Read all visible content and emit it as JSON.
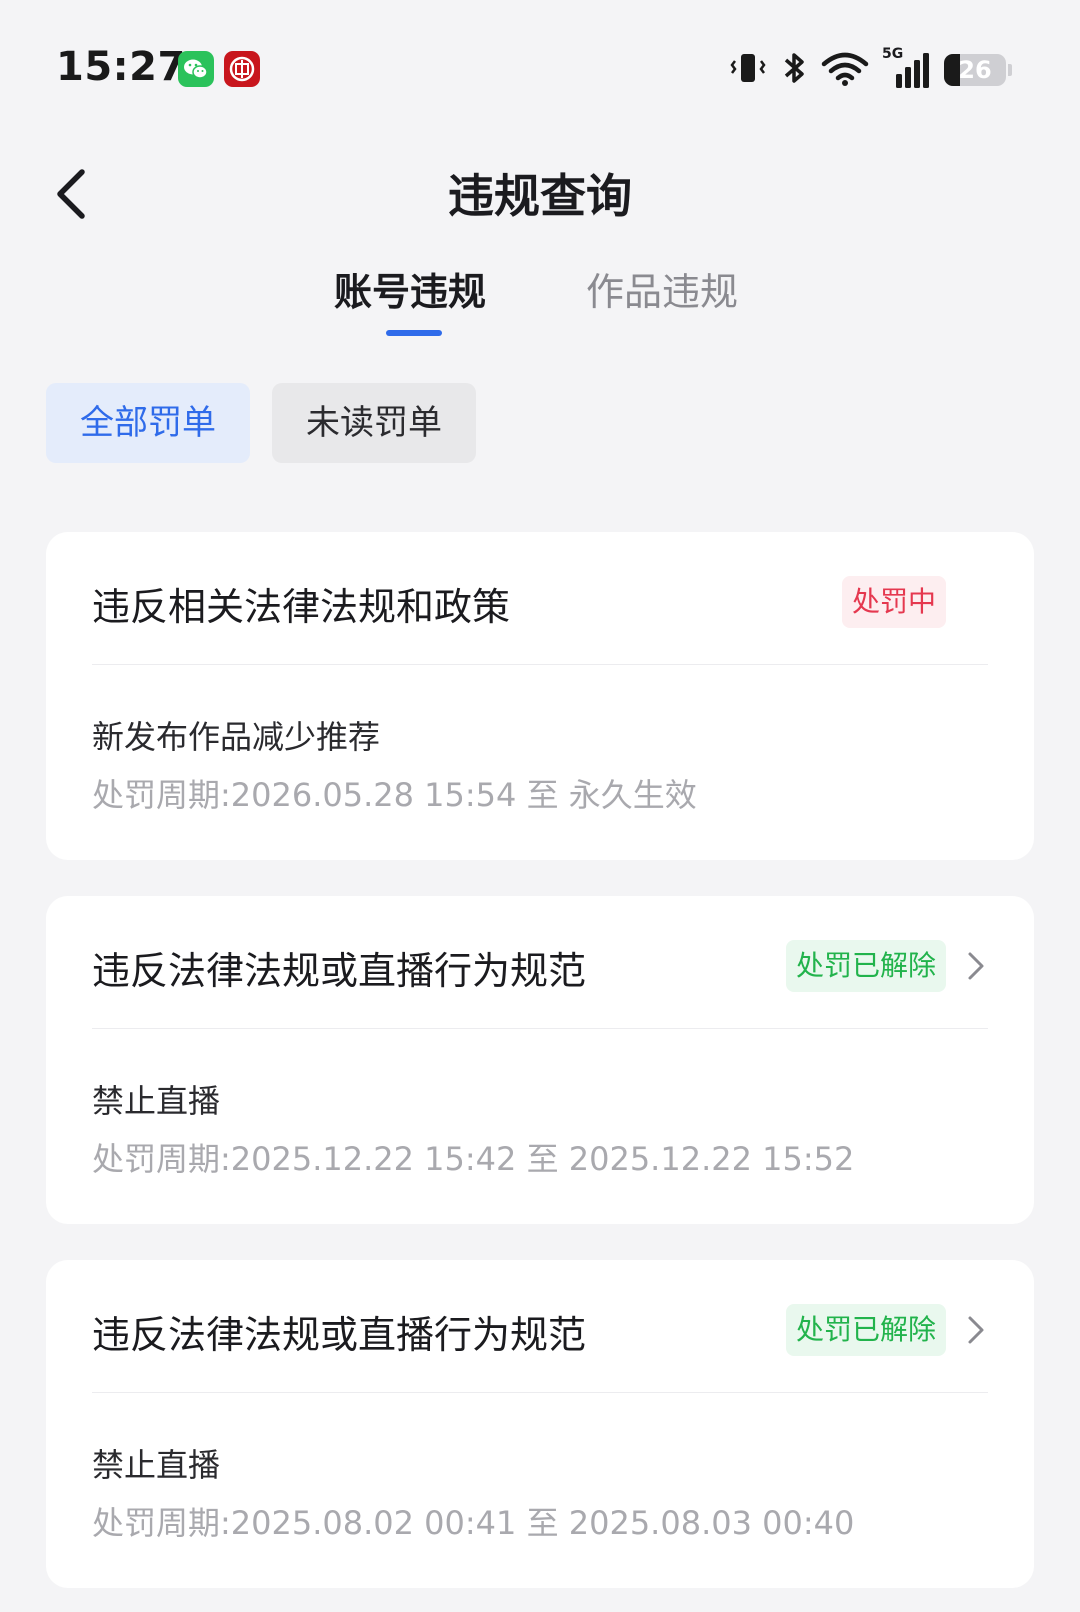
{
  "status_bar": {
    "time": "15:27",
    "network": "5G",
    "battery_level": "26",
    "battery_fraction": 0.26,
    "icons": [
      "wechat-icon",
      "bank-app-icon",
      "vibrate-icon",
      "bluetooth-icon",
      "wifi-icon",
      "cellular-signal-icon",
      "battery-icon"
    ]
  },
  "header": {
    "title": "违规查询"
  },
  "tabs": [
    {
      "label": "账号违规",
      "active": true
    },
    {
      "label": "作品违规",
      "active": false
    }
  ],
  "filters": [
    {
      "label": "全部罚单",
      "active": true
    },
    {
      "label": "未读罚单",
      "active": false
    }
  ],
  "cards": [
    {
      "title": "违反相关法律法规和政策",
      "status": "处罚中",
      "measure": "新发布作品减少推荐",
      "period": "处罚周期:2026.05.28 15:54 至 永久生效"
    },
    {
      "title": "违反法律法规或直播行为规范",
      "status": "处罚已解除",
      "measure": "禁止直播",
      "period": "处罚周期:2025.12.22 15:42 至 2025.12.22 15:52"
    },
    {
      "title": "违反法律法规或直播行为规范",
      "status": "处罚已解除",
      "measure": "禁止直播",
      "period": "处罚周期:2025.08.02 00:41 至 2025.08.03 00:40"
    }
  ],
  "colors": {
    "accent": "#2f6bea",
    "status_active": "#e5384f",
    "status_lifted": "#22b34c",
    "background": "#f4f4f6"
  }
}
